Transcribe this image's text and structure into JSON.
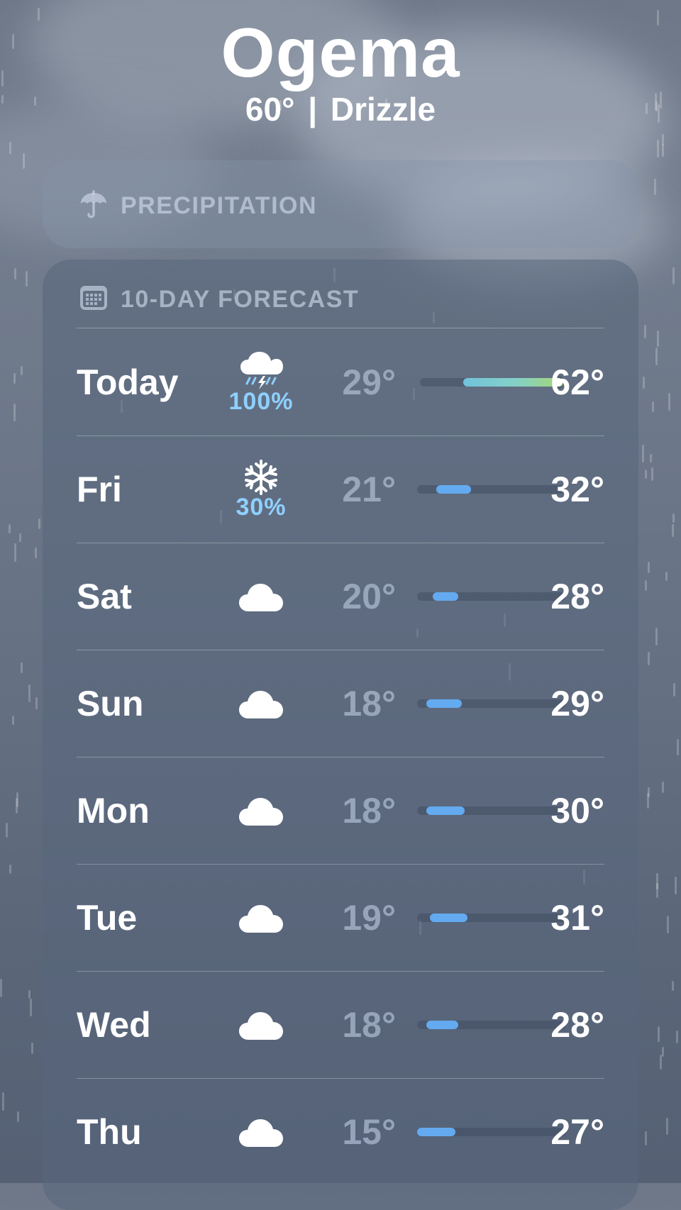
{
  "location": {
    "city": "Ogema",
    "temperature": "60°",
    "separator": "|",
    "condition": "Drizzle"
  },
  "precipitation": {
    "title": "PRECIPITATION",
    "icon": "umbrella-icon"
  },
  "forecast": {
    "title": "10-DAY FORECAST",
    "icon": "calendar-icon",
    "scale_min_deg": 15,
    "scale_max_deg": 62,
    "days": [
      {
        "day": "Today",
        "icon": "thunderstorm-icon",
        "chance": "100%",
        "low": "29°",
        "high": "62°",
        "low_value": 29,
        "high_value": 62,
        "current_value": 60,
        "bar_color": "warm"
      },
      {
        "day": "Fri",
        "icon": "snowflake-icon",
        "chance": "30%",
        "low": "21°",
        "high": "32°",
        "low_value": 21,
        "high_value": 32,
        "bar_color": "#63aaf0"
      },
      {
        "day": "Sat",
        "icon": "cloud-icon",
        "chance": "",
        "low": "20°",
        "high": "28°",
        "low_value": 20,
        "high_value": 28,
        "bar_color": "#63aaf0"
      },
      {
        "day": "Sun",
        "icon": "cloud-icon",
        "chance": "",
        "low": "18°",
        "high": "29°",
        "low_value": 18,
        "high_value": 29,
        "bar_color": "#63aaf0"
      },
      {
        "day": "Mon",
        "icon": "cloud-icon",
        "chance": "",
        "low": "18°",
        "high": "30°",
        "low_value": 18,
        "high_value": 30,
        "bar_color": "#63aaf0"
      },
      {
        "day": "Tue",
        "icon": "cloud-icon",
        "chance": "",
        "low": "19°",
        "high": "31°",
        "low_value": 19,
        "high_value": 31,
        "bar_color": "#63aaf0"
      },
      {
        "day": "Wed",
        "icon": "cloud-icon",
        "chance": "",
        "low": "18°",
        "high": "28°",
        "low_value": 18,
        "high_value": 28,
        "bar_color": "#63aaf0"
      },
      {
        "day": "Thu",
        "icon": "cloud-icon",
        "chance": "",
        "low": "15°",
        "high": "27°",
        "low_value": 15,
        "high_value": 27,
        "bar_color": "#63aaf0"
      }
    ]
  },
  "colors": {
    "precip_chance": "#8fd0ff",
    "bar_cool": "#63aaf0",
    "low_temp_text": "#afbdd2"
  }
}
